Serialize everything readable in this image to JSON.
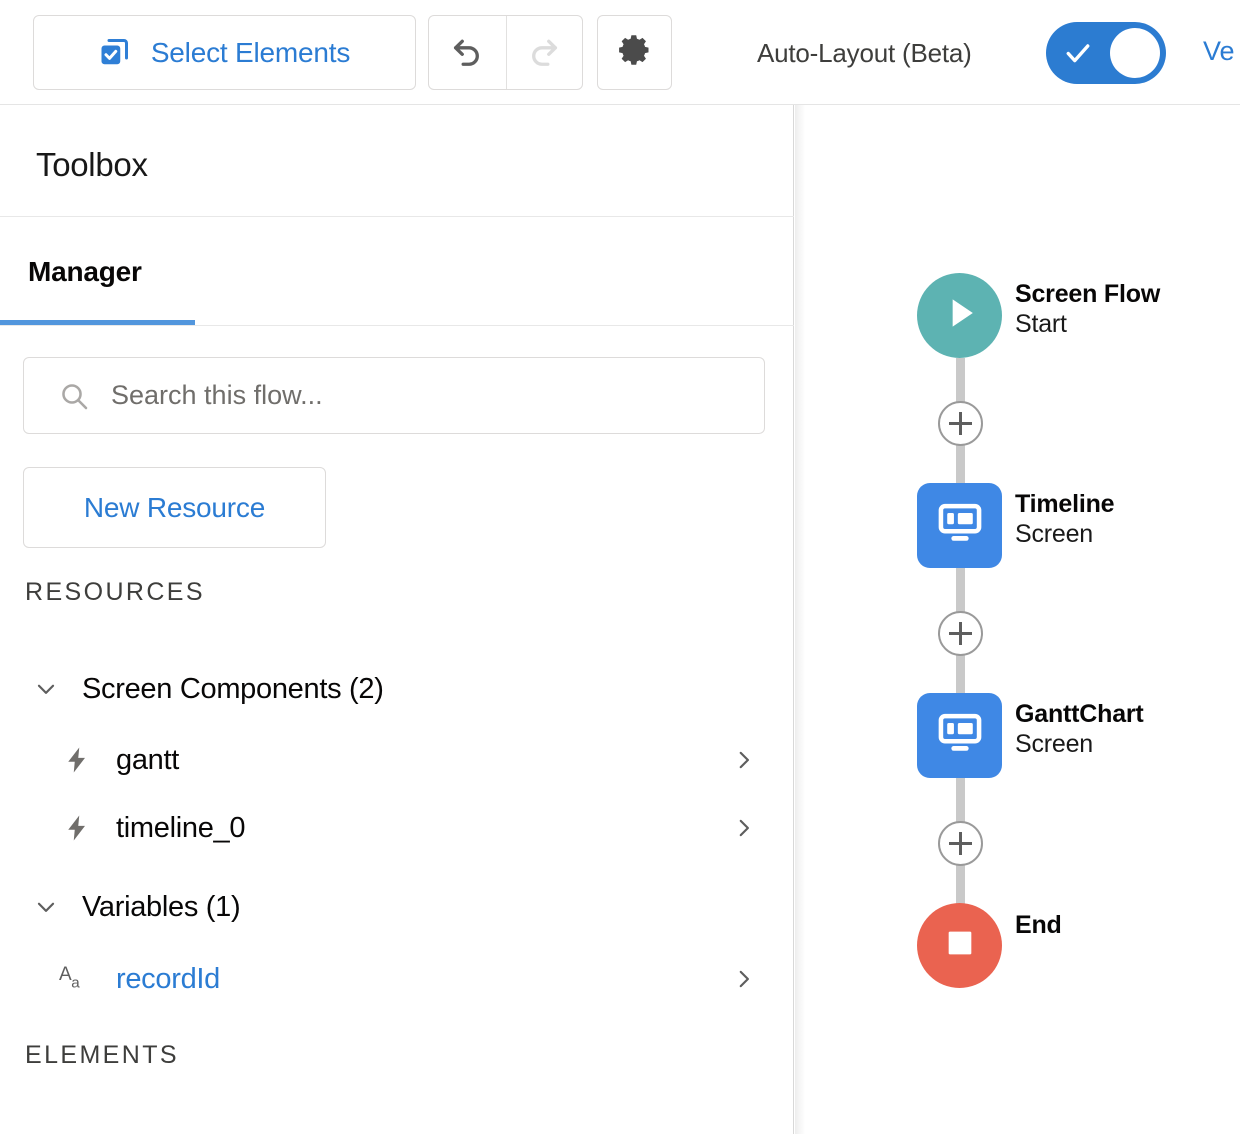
{
  "toolbar": {
    "select_elements_label": "Select Elements",
    "select_elements_icon": "select-elements-icon",
    "undo_icon": "undo-icon",
    "redo_icon": "redo-icon",
    "settings_icon": "gear-icon",
    "auto_layout_label": "Auto-Layout (Beta)",
    "auto_layout_toggle_state": "on",
    "toggle_check_icon": "check-icon",
    "right_link_truncated": "Ve",
    "accent_blue": "#2b7cd3",
    "toggle_on_color": "#2c7cd1"
  },
  "sidebar": {
    "title": "Toolbox",
    "tabs": [
      {
        "label": "Manager",
        "active": true
      }
    ],
    "search": {
      "placeholder": "Search this flow...",
      "value": "",
      "icon": "search-icon"
    },
    "new_resource_label": "New Resource",
    "sections": [
      {
        "label": "RESOURCES"
      },
      {
        "label": "ELEMENTS"
      }
    ],
    "groups": [
      {
        "label": "Screen Components (2)",
        "expanded": true,
        "chevron": "chevron-down-icon",
        "items": [
          {
            "label": "gantt",
            "icon": "lightning-bolt-icon",
            "chevron": "chevron-right-icon",
            "link": false
          },
          {
            "label": "timeline_0",
            "icon": "lightning-bolt-icon",
            "chevron": "chevron-right-icon",
            "link": false
          }
        ]
      },
      {
        "label": "Variables (1)",
        "expanded": true,
        "chevron": "chevron-down-icon",
        "items": [
          {
            "label": "recordId",
            "icon": "text-type-icon",
            "chevron": "chevron-right-icon",
            "link": true
          }
        ]
      }
    ]
  },
  "canvas": {
    "nodes": [
      {
        "title": "Screen Flow",
        "subtitle": "Start",
        "shape": "circle",
        "color": "#5db3b2",
        "icon": "play-icon"
      },
      {
        "title": "Timeline",
        "subtitle": "Screen",
        "shape": "square",
        "color": "#3f88e5",
        "icon": "screen-monitor-icon"
      },
      {
        "title": "GanttChart",
        "subtitle": "Screen",
        "shape": "square",
        "color": "#3f88e5",
        "icon": "screen-monitor-icon"
      },
      {
        "title": "End",
        "subtitle": "",
        "shape": "circle",
        "color": "#ea6350",
        "icon": "stop-square-icon"
      }
    ],
    "connectors": [
      {
        "add_icon": "plus-icon"
      },
      {
        "add_icon": "plus-icon"
      },
      {
        "add_icon": "plus-icon"
      }
    ],
    "connector_color": "#c9c9c9"
  }
}
